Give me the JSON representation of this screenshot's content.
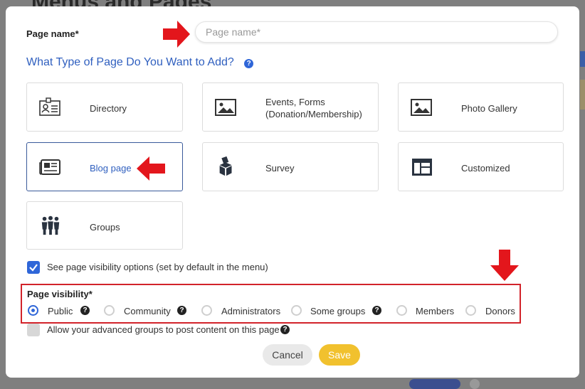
{
  "background": {
    "title": "Menus and Pages"
  },
  "modal": {
    "page_name_label": "Page name*",
    "page_name_placeholder": "Page name*",
    "page_name_value": "",
    "type_title": "What Type of Page Do You Want to Add?",
    "page_types": [
      {
        "label": "Directory",
        "icon": "contact-card-icon",
        "selected": false
      },
      {
        "label": "Events, Forms",
        "label2": "(Donation/Membership)",
        "icon": "image-icon",
        "selected": false
      },
      {
        "label": "Photo Gallery",
        "icon": "image-icon",
        "selected": false
      },
      {
        "label": "Blog page",
        "icon": "newspaper-icon",
        "selected": true
      },
      {
        "label": "Survey",
        "icon": "ballot-box-icon",
        "selected": false
      },
      {
        "label": "Customized",
        "icon": "layout-icon",
        "selected": false
      },
      {
        "label": "Groups",
        "icon": "people-icon",
        "selected": false
      }
    ],
    "visibility_options_checkbox": {
      "label": "See page visibility options (set by default in the menu)",
      "checked": true
    },
    "visibility_label": "Page visibility*",
    "visibility_options": [
      {
        "label": "Public",
        "selected": true,
        "help": true
      },
      {
        "label": "Community",
        "selected": false,
        "help": true
      },
      {
        "label": "Administrators",
        "selected": false,
        "help": false
      },
      {
        "label": "Some groups",
        "selected": false,
        "help": true
      },
      {
        "label": "Members",
        "selected": false,
        "help": false
      },
      {
        "label": "Donors",
        "selected": false,
        "help": false
      }
    ],
    "advanced_groups_checkbox": {
      "label": "Allow your advanced groups to post content on this page",
      "checked": false
    },
    "cancel_label": "Cancel",
    "save_label": "Save",
    "help_glyph": "?"
  },
  "colors": {
    "accent": "#2f66d8",
    "save": "#f1c12e",
    "annotation": "#e3161c"
  }
}
